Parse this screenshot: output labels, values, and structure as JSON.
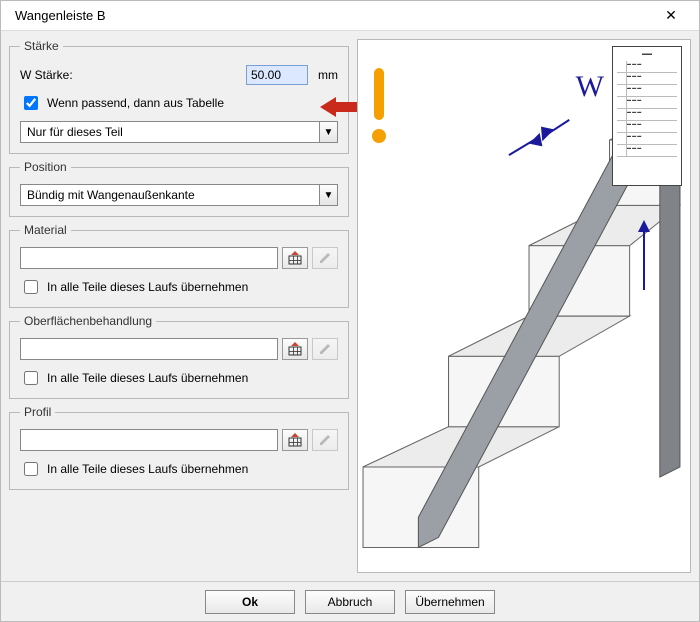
{
  "window": {
    "title": "Wangenleiste B",
    "close": "✕"
  },
  "staerke": {
    "legend": "Stärke",
    "w_label": "W Stärke:",
    "w_value": "50.00",
    "unit": "mm",
    "cb_table": "Wenn passend, dann aus Tabelle",
    "cb_table_checked": true,
    "scope_value": "Nur für dieses Teil"
  },
  "position": {
    "legend": "Position",
    "value": "Bündig mit Wangenaußenkante"
  },
  "material": {
    "legend": "Material",
    "value": "",
    "cb_apply": "In alle Teile dieses Laufs übernehmen"
  },
  "surface": {
    "legend": "Oberflächenbehandlung",
    "value": "",
    "cb_apply": "In alle Teile dieses Laufs übernehmen"
  },
  "profile": {
    "legend": "Profil",
    "value": "",
    "cb_apply": "In alle Teile dieses Laufs übernehmen"
  },
  "buttons": {
    "ok": "Ok",
    "cancel": "Abbruch",
    "apply": "Übernehmen"
  },
  "preview": {
    "w_letter": "W"
  }
}
